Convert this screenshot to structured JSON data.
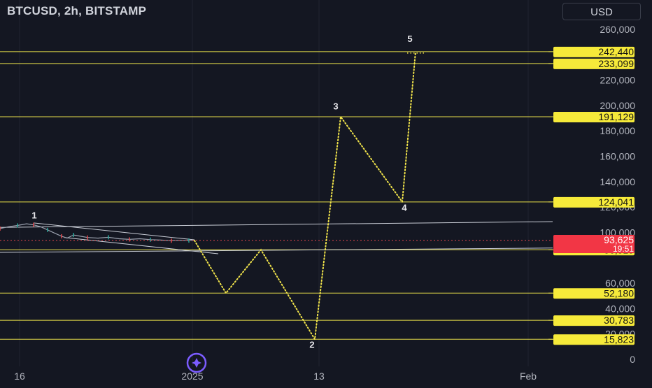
{
  "header": {
    "title": "BTCUSD, 2h, BITSTAMP",
    "currency": "USD"
  },
  "chart_data": {
    "type": "line",
    "ylim": [
      0,
      270000
    ],
    "y_ticks": [
      {
        "value": 0,
        "label": "0"
      },
      {
        "value": 20000,
        "label": "20,000"
      },
      {
        "value": 40000,
        "label": "40,000"
      },
      {
        "value": 60000,
        "label": "60,000"
      },
      {
        "value": 100000,
        "label": "100,000"
      },
      {
        "value": 120000,
        "label": "120,000"
      },
      {
        "value": 140000,
        "label": "140,000"
      },
      {
        "value": 160000,
        "label": "160,000"
      },
      {
        "value": 180000,
        "label": "180,000"
      },
      {
        "value": 200000,
        "label": "200,000"
      },
      {
        "value": 220000,
        "label": "220,000"
      },
      {
        "value": 260000,
        "label": "260,000"
      }
    ],
    "x_ticks": [
      "16",
      "2025",
      "13",
      "Feb"
    ],
    "horizontal_levels": [
      {
        "value": 242440,
        "label": "242,440"
      },
      {
        "value": 233099,
        "label": "233,099"
      },
      {
        "value": 191129,
        "label": "191,129"
      },
      {
        "value": 124041,
        "label": "124,041"
      },
      {
        "value": 86319,
        "label": "86,319"
      },
      {
        "value": 52180,
        "label": "52,180"
      },
      {
        "value": 30783,
        "label": "30,783"
      },
      {
        "value": 15823,
        "label": "15,823"
      }
    ],
    "current_price": {
      "value": 93625,
      "label": "93,625",
      "countdown": "19:51"
    },
    "price_history": [
      {
        "x": 0,
        "y": 103000
      },
      {
        "x": 12,
        "y": 104500
      },
      {
        "x": 25,
        "y": 105500
      },
      {
        "x": 38,
        "y": 106800
      },
      {
        "x": 48,
        "y": 106000
      },
      {
        "x": 58,
        "y": 104500
      },
      {
        "x": 68,
        "y": 102000
      },
      {
        "x": 78,
        "y": 99500
      },
      {
        "x": 88,
        "y": 97000
      },
      {
        "x": 96,
        "y": 95500
      },
      {
        "x": 105,
        "y": 98000
      },
      {
        "x": 115,
        "y": 97000
      },
      {
        "x": 125,
        "y": 96000
      },
      {
        "x": 140,
        "y": 95500
      },
      {
        "x": 155,
        "y": 96200
      },
      {
        "x": 170,
        "y": 95000
      },
      {
        "x": 185,
        "y": 94500
      },
      {
        "x": 200,
        "y": 95000
      },
      {
        "x": 215,
        "y": 94300
      },
      {
        "x": 230,
        "y": 94000
      },
      {
        "x": 245,
        "y": 93500
      },
      {
        "x": 258,
        "y": 93800
      },
      {
        "x": 270,
        "y": 93600
      },
      {
        "x": 278,
        "y": 93625
      }
    ],
    "projection": [
      {
        "x": 278,
        "y": 93625
      },
      {
        "x": 323,
        "y": 52180
      },
      {
        "x": 373,
        "y": 86319
      },
      {
        "x": 450,
        "y": 15823
      },
      {
        "x": 487,
        "y": 191129
      },
      {
        "x": 575,
        "y": 124041
      },
      {
        "x": 594,
        "y": 242440
      }
    ],
    "wave_labels": [
      {
        "label": "1",
        "x": 49,
        "y": 111000
      },
      {
        "label": "2",
        "x": 446,
        "y": 9000
      },
      {
        "label": "3",
        "x": 480,
        "y": 197000
      },
      {
        "label": "4",
        "x": 578,
        "y": 117000
      },
      {
        "label": "5",
        "x": 586,
        "y": 250000
      }
    ],
    "trendlines": [
      {
        "from": {
          "x": 0,
          "y": 104000
        },
        "to": {
          "x": 790,
          "y": 108500
        }
      },
      {
        "from": {
          "x": 48,
          "y": 107500
        },
        "to": {
          "x": 278,
          "y": 94200
        }
      },
      {
        "from": {
          "x": 92,
          "y": 96000
        },
        "to": {
          "x": 312,
          "y": 83200
        }
      },
      {
        "from": {
          "x": 0,
          "y": 84300
        },
        "to": {
          "x": 790,
          "y": 87700
        }
      }
    ],
    "colors": {
      "background": "#141722",
      "level_line": "#e6de4a",
      "level_badge": "#f6ea3a",
      "projection": "#f0e34a",
      "trendline": "#c9cdd6",
      "price_line": "#e0454a",
      "price_badge": "#f23645",
      "axis_text": "#b2b5be",
      "grid": "#1f2330",
      "history": "#9aa0ad",
      "icon_accent": "#7b5cff"
    }
  }
}
